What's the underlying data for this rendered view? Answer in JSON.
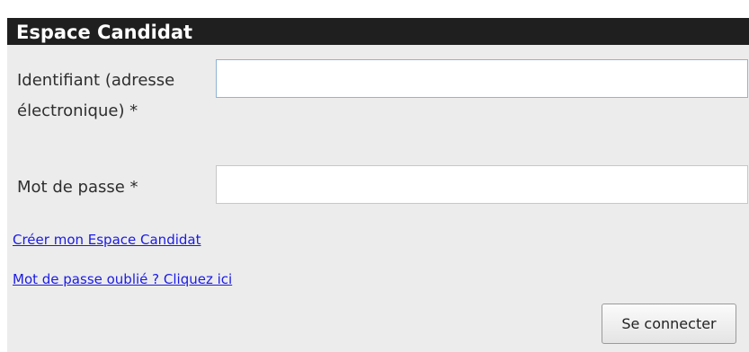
{
  "panel": {
    "title": "Espace Candidat"
  },
  "form": {
    "identifier_label": "Identifiant (adresse électronique) *",
    "identifier_value": "",
    "password_label": "Mot de passe *",
    "password_value": ""
  },
  "links": {
    "create_account": "Créer mon Espace Candidat",
    "forgot_password": "Mot de passe oublié ? Cliquez ici"
  },
  "actions": {
    "login_label": "Se connecter"
  }
}
